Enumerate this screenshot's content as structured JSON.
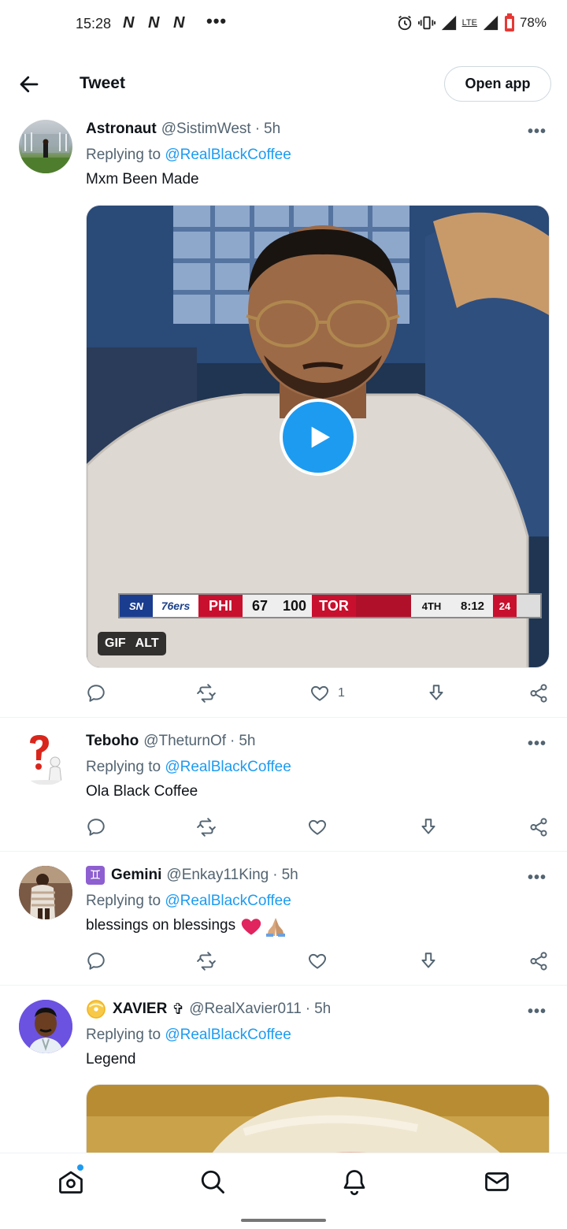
{
  "status_bar": {
    "time": "15:28",
    "app_icons": "N N N",
    "more": "•••",
    "network": "LTE",
    "battery": "78%"
  },
  "header": {
    "title": "Tweet",
    "open_app": "Open app"
  },
  "tweets": [
    {
      "name": "Astronaut",
      "handle": "@SistimWest",
      "separator": "·",
      "time": "5h",
      "replying_prefix": "Replying to ",
      "replying_to": "@RealBlackCoffee",
      "text": "Mxm Been Made",
      "like_count": "1",
      "media": {
        "badge_gif": "GIF",
        "badge_alt": "ALT",
        "score": {
          "network": "SN",
          "team1_logo": "76ers",
          "team1": "PHI",
          "score1": "67",
          "score2": "100",
          "team2": "TOR",
          "period": "4TH",
          "clock": "8:12",
          "shot_clock": "24"
        }
      }
    },
    {
      "name": "Teboho",
      "handle": "@TheturnOf",
      "separator": "·",
      "time": "5h",
      "replying_prefix": "Replying to ",
      "replying_to": "@RealBlackCoffee",
      "text": "Ola Black Coffee"
    },
    {
      "name_prefix": "♊",
      "name": "Gemini",
      "handle": "@Enkay11King",
      "separator": "·",
      "time": "5h",
      "replying_prefix": "Replying to ",
      "replying_to": "@RealBlackCoffee",
      "text": "blessings on blessings"
    },
    {
      "name_prefix": "📀",
      "name": "XAVIER",
      "name_suffix": "✞",
      "handle": "@RealXavier011",
      "separator": "·",
      "time": "5h",
      "replying_prefix": "Replying to ",
      "replying_to": "@RealBlackCoffee",
      "text": "Legend"
    }
  ],
  "colors": {
    "accent": "#1d9bf0",
    "text": "#0f1419",
    "secondary": "#536471",
    "like_heart_emoji": "#e0245e"
  },
  "bottom_nav": [
    "home-icon",
    "search-icon",
    "notifications-icon",
    "messages-icon"
  ]
}
